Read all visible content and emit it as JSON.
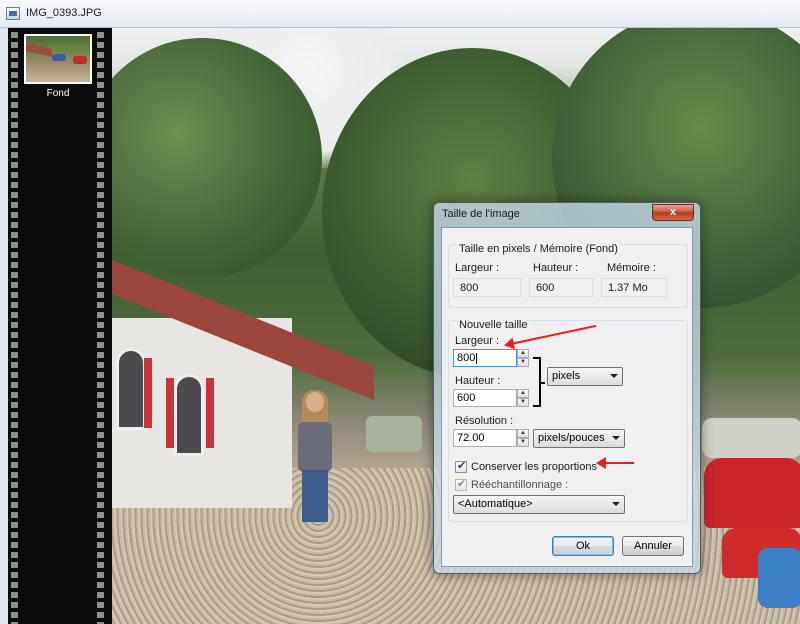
{
  "window": {
    "title": "IMG_0393.JPG"
  },
  "filmstrip": {
    "thumb_label": "Fond"
  },
  "dialog": {
    "title": "Taille de l'image",
    "close_glyph": "x",
    "pixel_memory": {
      "group_label": "Taille en pixels / Mémoire (Fond)",
      "width_label": "Largeur :",
      "height_label": "Hauteur :",
      "memory_label": "Mémoire :",
      "width_value": "800",
      "height_value": "600",
      "memory_value": "1.37 Mo"
    },
    "new_size": {
      "group_label": "Nouvelle taille",
      "width_label": "Largeur :",
      "width_value": "800",
      "height_label": "Hauteur :",
      "height_value": "600",
      "size_unit": "pixels",
      "resolution_label": "Résolution :",
      "resolution_value": "72.00",
      "resolution_unit": "pixels/pouces",
      "keep_proportions_label": "Conserver les proportions",
      "keep_proportions_checked": true,
      "resample_label": "Rééchantillonnage :",
      "resample_checked": true,
      "resample_method": "<Automatique>"
    },
    "ok_label": "Ok",
    "cancel_label": "Annuler"
  },
  "colors": {
    "annotation_arrow": "#e8211f",
    "close_button": "#c9452a",
    "dialog_frame": "#c6d8eb"
  },
  "icons": {
    "app": "image-file-icon",
    "close": "close-icon",
    "spin_up": "spin-up-icon",
    "spin_down": "spin-down-icon",
    "dropdown": "chevron-down-icon",
    "check": "checkmark-icon"
  }
}
